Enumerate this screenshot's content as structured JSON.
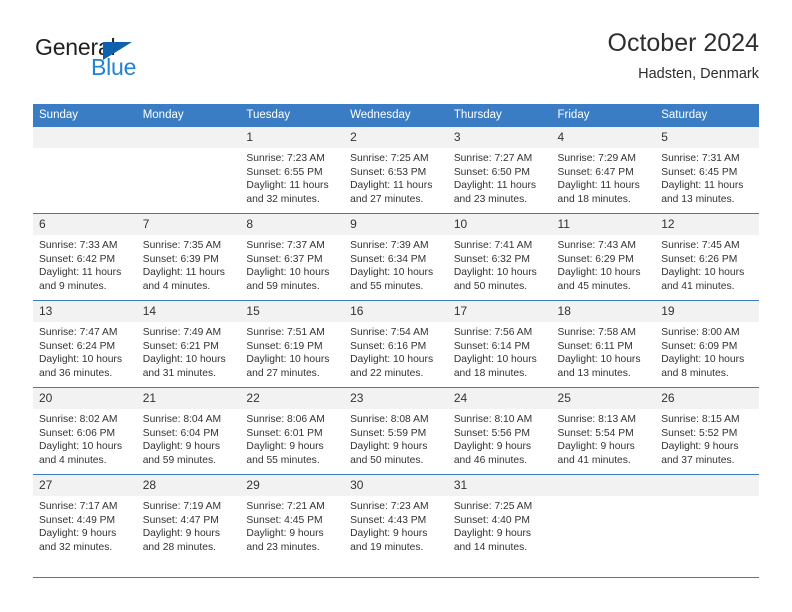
{
  "brand": {
    "name_top": "General",
    "name_bottom": "Blue",
    "color_dark": "#231f20",
    "color_blue": "#2183d6",
    "triangle_color": "#1061ad"
  },
  "header": {
    "title": "October 2024",
    "subtitle": "Hadsten, Denmark"
  },
  "theme": {
    "header_bg": "#3b7dc4",
    "daynum_bg": "#f2f2f2",
    "grid_line": "#3b7dc4",
    "text": "#333333"
  },
  "weekday_headers": [
    "Sunday",
    "Monday",
    "Tuesday",
    "Wednesday",
    "Thursday",
    "Friday",
    "Saturday"
  ],
  "weeks": [
    [
      {
        "day": "",
        "empty": true
      },
      {
        "day": "",
        "empty": true
      },
      {
        "day": "1",
        "sunrise": "Sunrise: 7:23 AM",
        "sunset": "Sunset: 6:55 PM",
        "daylight1": "Daylight: 11 hours",
        "daylight2": "and 32 minutes."
      },
      {
        "day": "2",
        "sunrise": "Sunrise: 7:25 AM",
        "sunset": "Sunset: 6:53 PM",
        "daylight1": "Daylight: 11 hours",
        "daylight2": "and 27 minutes."
      },
      {
        "day": "3",
        "sunrise": "Sunrise: 7:27 AM",
        "sunset": "Sunset: 6:50 PM",
        "daylight1": "Daylight: 11 hours",
        "daylight2": "and 23 minutes."
      },
      {
        "day": "4",
        "sunrise": "Sunrise: 7:29 AM",
        "sunset": "Sunset: 6:47 PM",
        "daylight1": "Daylight: 11 hours",
        "daylight2": "and 18 minutes."
      },
      {
        "day": "5",
        "sunrise": "Sunrise: 7:31 AM",
        "sunset": "Sunset: 6:45 PM",
        "daylight1": "Daylight: 11 hours",
        "daylight2": "and 13 minutes."
      }
    ],
    [
      {
        "day": "6",
        "sunrise": "Sunrise: 7:33 AM",
        "sunset": "Sunset: 6:42 PM",
        "daylight1": "Daylight: 11 hours",
        "daylight2": "and 9 minutes."
      },
      {
        "day": "7",
        "sunrise": "Sunrise: 7:35 AM",
        "sunset": "Sunset: 6:39 PM",
        "daylight1": "Daylight: 11 hours",
        "daylight2": "and 4 minutes."
      },
      {
        "day": "8",
        "sunrise": "Sunrise: 7:37 AM",
        "sunset": "Sunset: 6:37 PM",
        "daylight1": "Daylight: 10 hours",
        "daylight2": "and 59 minutes."
      },
      {
        "day": "9",
        "sunrise": "Sunrise: 7:39 AM",
        "sunset": "Sunset: 6:34 PM",
        "daylight1": "Daylight: 10 hours",
        "daylight2": "and 55 minutes."
      },
      {
        "day": "10",
        "sunrise": "Sunrise: 7:41 AM",
        "sunset": "Sunset: 6:32 PM",
        "daylight1": "Daylight: 10 hours",
        "daylight2": "and 50 minutes."
      },
      {
        "day": "11",
        "sunrise": "Sunrise: 7:43 AM",
        "sunset": "Sunset: 6:29 PM",
        "daylight1": "Daylight: 10 hours",
        "daylight2": "and 45 minutes."
      },
      {
        "day": "12",
        "sunrise": "Sunrise: 7:45 AM",
        "sunset": "Sunset: 6:26 PM",
        "daylight1": "Daylight: 10 hours",
        "daylight2": "and 41 minutes."
      }
    ],
    [
      {
        "day": "13",
        "sunrise": "Sunrise: 7:47 AM",
        "sunset": "Sunset: 6:24 PM",
        "daylight1": "Daylight: 10 hours",
        "daylight2": "and 36 minutes."
      },
      {
        "day": "14",
        "sunrise": "Sunrise: 7:49 AM",
        "sunset": "Sunset: 6:21 PM",
        "daylight1": "Daylight: 10 hours",
        "daylight2": "and 31 minutes."
      },
      {
        "day": "15",
        "sunrise": "Sunrise: 7:51 AM",
        "sunset": "Sunset: 6:19 PM",
        "daylight1": "Daylight: 10 hours",
        "daylight2": "and 27 minutes."
      },
      {
        "day": "16",
        "sunrise": "Sunrise: 7:54 AM",
        "sunset": "Sunset: 6:16 PM",
        "daylight1": "Daylight: 10 hours",
        "daylight2": "and 22 minutes."
      },
      {
        "day": "17",
        "sunrise": "Sunrise: 7:56 AM",
        "sunset": "Sunset: 6:14 PM",
        "daylight1": "Daylight: 10 hours",
        "daylight2": "and 18 minutes."
      },
      {
        "day": "18",
        "sunrise": "Sunrise: 7:58 AM",
        "sunset": "Sunset: 6:11 PM",
        "daylight1": "Daylight: 10 hours",
        "daylight2": "and 13 minutes."
      },
      {
        "day": "19",
        "sunrise": "Sunrise: 8:00 AM",
        "sunset": "Sunset: 6:09 PM",
        "daylight1": "Daylight: 10 hours",
        "daylight2": "and 8 minutes."
      }
    ],
    [
      {
        "day": "20",
        "sunrise": "Sunrise: 8:02 AM",
        "sunset": "Sunset: 6:06 PM",
        "daylight1": "Daylight: 10 hours",
        "daylight2": "and 4 minutes."
      },
      {
        "day": "21",
        "sunrise": "Sunrise: 8:04 AM",
        "sunset": "Sunset: 6:04 PM",
        "daylight1": "Daylight: 9 hours",
        "daylight2": "and 59 minutes."
      },
      {
        "day": "22",
        "sunrise": "Sunrise: 8:06 AM",
        "sunset": "Sunset: 6:01 PM",
        "daylight1": "Daylight: 9 hours",
        "daylight2": "and 55 minutes."
      },
      {
        "day": "23",
        "sunrise": "Sunrise: 8:08 AM",
        "sunset": "Sunset: 5:59 PM",
        "daylight1": "Daylight: 9 hours",
        "daylight2": "and 50 minutes."
      },
      {
        "day": "24",
        "sunrise": "Sunrise: 8:10 AM",
        "sunset": "Sunset: 5:56 PM",
        "daylight1": "Daylight: 9 hours",
        "daylight2": "and 46 minutes."
      },
      {
        "day": "25",
        "sunrise": "Sunrise: 8:13 AM",
        "sunset": "Sunset: 5:54 PM",
        "daylight1": "Daylight: 9 hours",
        "daylight2": "and 41 minutes."
      },
      {
        "day": "26",
        "sunrise": "Sunrise: 8:15 AM",
        "sunset": "Sunset: 5:52 PM",
        "daylight1": "Daylight: 9 hours",
        "daylight2": "and 37 minutes."
      }
    ],
    [
      {
        "day": "27",
        "sunrise": "Sunrise: 7:17 AM",
        "sunset": "Sunset: 4:49 PM",
        "daylight1": "Daylight: 9 hours",
        "daylight2": "and 32 minutes."
      },
      {
        "day": "28",
        "sunrise": "Sunrise: 7:19 AM",
        "sunset": "Sunset: 4:47 PM",
        "daylight1": "Daylight: 9 hours",
        "daylight2": "and 28 minutes."
      },
      {
        "day": "29",
        "sunrise": "Sunrise: 7:21 AM",
        "sunset": "Sunset: 4:45 PM",
        "daylight1": "Daylight: 9 hours",
        "daylight2": "and 23 minutes."
      },
      {
        "day": "30",
        "sunrise": "Sunrise: 7:23 AM",
        "sunset": "Sunset: 4:43 PM",
        "daylight1": "Daylight: 9 hours",
        "daylight2": "and 19 minutes."
      },
      {
        "day": "31",
        "sunrise": "Sunrise: 7:25 AM",
        "sunset": "Sunset: 4:40 PM",
        "daylight1": "Daylight: 9 hours",
        "daylight2": "and 14 minutes."
      },
      {
        "day": "",
        "empty": true
      },
      {
        "day": "",
        "empty": true
      }
    ]
  ]
}
